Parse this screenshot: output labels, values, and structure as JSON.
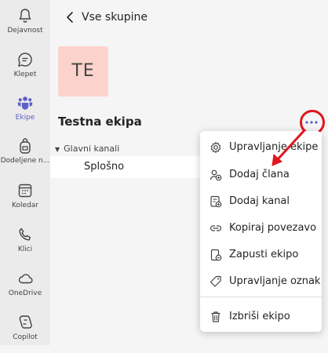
{
  "rail": {
    "items": [
      {
        "label": "Dejavnost",
        "icon": "bell-icon"
      },
      {
        "label": "Klepet",
        "icon": "chat-icon"
      },
      {
        "label": "Ekipe",
        "icon": "teams-icon",
        "active": true
      },
      {
        "label": "Dodeljene n...",
        "icon": "backpack-icon"
      },
      {
        "label": "Koledar",
        "icon": "calendar-icon"
      },
      {
        "label": "Klici",
        "icon": "phone-icon"
      },
      {
        "label": "OneDrive",
        "icon": "cloud-icon"
      },
      {
        "label": "Copilot",
        "icon": "copilot-icon"
      }
    ]
  },
  "header": {
    "back_label": "Vse skupine"
  },
  "team": {
    "initials": "TE",
    "name": "Testna ekipa",
    "avatar_color": "#fcd3cc"
  },
  "channels": {
    "group_label": "Glavni kanali",
    "items": [
      {
        "label": "Splošno"
      }
    ]
  },
  "menu": {
    "items": [
      {
        "label": "Upravljanje ekipe",
        "icon": "gear-icon"
      },
      {
        "label": "Dodaj člana",
        "icon": "add-person-icon"
      },
      {
        "label": "Dodaj kanal",
        "icon": "add-channel-icon"
      },
      {
        "label": "Kopiraj povezavo",
        "icon": "link-icon"
      },
      {
        "label": "Zapusti ekipo",
        "icon": "leave-icon"
      },
      {
        "label": "Upravljanje oznak",
        "icon": "tag-icon"
      },
      {
        "label": "Izbriši ekipo",
        "icon": "trash-icon"
      }
    ]
  },
  "colors": {
    "accent": "#5b5fc7",
    "highlight": "#e0161e",
    "avatar": "#fcd3cc"
  }
}
